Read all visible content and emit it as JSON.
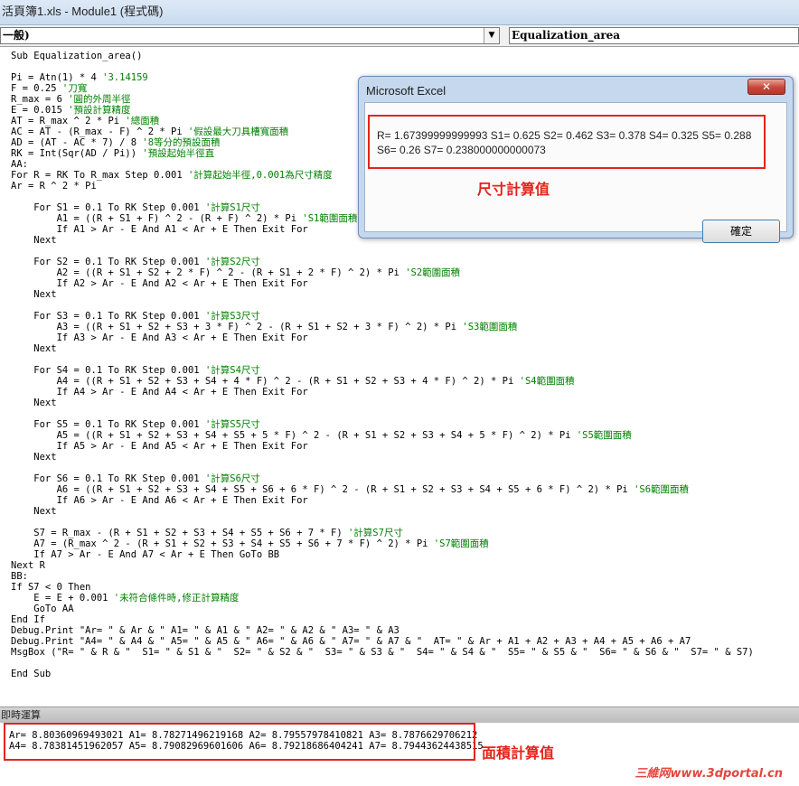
{
  "window": {
    "title": "活頁簿1.xls - Module1 (程式碼)"
  },
  "combos": {
    "object": "一般)",
    "procedure": "Equalization_area",
    "arrow": "▼"
  },
  "code": [
    [
      {
        "t": "Sub Equalization_area()"
      }
    ],
    [],
    [
      {
        "t": "Pi = Atn(1) * 4 "
      },
      {
        "t": "'3.14159",
        "c": "c"
      }
    ],
    [
      {
        "t": "F = 0.25 "
      },
      {
        "t": "'刀寬",
        "c": "c"
      }
    ],
    [
      {
        "t": "R_max = 6 "
      },
      {
        "t": "'圓的外周半徑",
        "c": "c"
      }
    ],
    [
      {
        "t": "E = 0.015 "
      },
      {
        "t": "'預設計算精度",
        "c": "c"
      }
    ],
    [
      {
        "t": "AT = R_max ^ 2 * Pi "
      },
      {
        "t": "'總面積",
        "c": "c"
      }
    ],
    [
      {
        "t": "AC = AT - (R_max - F) ^ 2 * Pi "
      },
      {
        "t": "'假設最大刀具槽寬面積",
        "c": "c"
      }
    ],
    [
      {
        "t": "AD = (AT - AC * 7) / 8 "
      },
      {
        "t": "'8等分的預設面積",
        "c": "c"
      }
    ],
    [
      {
        "t": "RK = Int(Sqr(AD / Pi)) "
      },
      {
        "t": "'預設起始半徑直",
        "c": "c"
      }
    ],
    [
      {
        "t": "AA:"
      }
    ],
    [
      {
        "t": "For R = RK To R_max Step 0.001 "
      },
      {
        "t": "'計算起始半徑,0.001為尺寸精度",
        "c": "c"
      }
    ],
    [
      {
        "t": "Ar = R ^ 2 * Pi"
      }
    ],
    [],
    [
      {
        "t": "    For S1 = 0.1 To RK Step 0.001 "
      },
      {
        "t": "'計算S1尺寸",
        "c": "c"
      }
    ],
    [
      {
        "t": "        A1 = ((R + S1 + F) ^ 2 - (R + F) ^ 2) * Pi "
      },
      {
        "t": "'S1範圍面積",
        "c": "c"
      }
    ],
    [
      {
        "t": "        If A1 > Ar - E And A1 < Ar + E Then Exit For"
      }
    ],
    [
      {
        "t": "    Next"
      }
    ],
    [],
    [
      {
        "t": "    For S2 = 0.1 To RK Step 0.001 "
      },
      {
        "t": "'計算S2尺寸",
        "c": "c"
      }
    ],
    [
      {
        "t": "        A2 = ((R + S1 + S2 + 2 * F) ^ 2 - (R + S1 + 2 * F) ^ 2) * Pi "
      },
      {
        "t": "'S2範圍面積",
        "c": "c"
      }
    ],
    [
      {
        "t": "        If A2 > Ar - E And A2 < Ar + E Then Exit For"
      }
    ],
    [
      {
        "t": "    Next"
      }
    ],
    [],
    [
      {
        "t": "    For S3 = 0.1 To RK Step 0.001 "
      },
      {
        "t": "'計算S3尺寸",
        "c": "c"
      }
    ],
    [
      {
        "t": "        A3 = ((R + S1 + S2 + S3 + 3 * F) ^ 2 - (R + S1 + S2 + 3 * F) ^ 2) * Pi "
      },
      {
        "t": "'S3範圍面積",
        "c": "c"
      }
    ],
    [
      {
        "t": "        If A3 > Ar - E And A3 < Ar + E Then Exit For"
      }
    ],
    [
      {
        "t": "    Next"
      }
    ],
    [],
    [
      {
        "t": "    For S4 = 0.1 To RK Step 0.001 "
      },
      {
        "t": "'計算S4尺寸",
        "c": "c"
      }
    ],
    [
      {
        "t": "        A4 = ((R + S1 + S2 + S3 + S4 + 4 * F) ^ 2 - (R + S1 + S2 + S3 + 4 * F) ^ 2) * Pi "
      },
      {
        "t": "'S4範圍面積",
        "c": "c"
      }
    ],
    [
      {
        "t": "        If A4 > Ar - E And A4 < Ar + E Then Exit For"
      }
    ],
    [
      {
        "t": "    Next"
      }
    ],
    [],
    [
      {
        "t": "    For S5 = 0.1 To RK Step 0.001 "
      },
      {
        "t": "'計算S5尺寸",
        "c": "c"
      }
    ],
    [
      {
        "t": "        A5 = ((R + S1 + S2 + S3 + S4 + S5 + 5 * F) ^ 2 - (R + S1 + S2 + S3 + S4 + 5 * F) ^ 2) * Pi "
      },
      {
        "t": "'S5範圍面積",
        "c": "c"
      }
    ],
    [
      {
        "t": "        If A5 > Ar - E And A5 < Ar + E Then Exit For"
      }
    ],
    [
      {
        "t": "    Next"
      }
    ],
    [],
    [
      {
        "t": "    For S6 = 0.1 To RK Step 0.001 "
      },
      {
        "t": "'計算S6尺寸",
        "c": "c"
      }
    ],
    [
      {
        "t": "        A6 = ((R + S1 + S2 + S3 + S4 + S5 + S6 + 6 * F) ^ 2 - (R + S1 + S2 + S3 + S4 + S5 + 6 * F) ^ 2) * Pi "
      },
      {
        "t": "'S6範圍面積",
        "c": "c"
      }
    ],
    [
      {
        "t": "        If A6 > Ar - E And A6 < Ar + E Then Exit For"
      }
    ],
    [
      {
        "t": "    Next"
      }
    ],
    [],
    [
      {
        "t": "    S7 = R_max - (R + S1 + S2 + S3 + S4 + S5 + S6 + 7 * F) "
      },
      {
        "t": "'計算S7尺寸",
        "c": "c"
      }
    ],
    [
      {
        "t": "    A7 = (R_max ^ 2 - (R + S1 + S2 + S3 + S4 + S5 + S6 + 7 * F) ^ 2) * Pi "
      },
      {
        "t": "'S7範圍面積",
        "c": "c"
      }
    ],
    [
      {
        "t": "    If A7 > Ar - E And A7 < Ar + E Then GoTo BB"
      }
    ],
    [
      {
        "t": "Next R"
      }
    ],
    [
      {
        "t": "BB:"
      }
    ],
    [
      {
        "t": "If S7 < 0 Then"
      }
    ],
    [
      {
        "t": "    E = E + 0.001 "
      },
      {
        "t": "'未符合條件時,修正計算精度",
        "c": "c"
      }
    ],
    [
      {
        "t": "    GoTo AA"
      }
    ],
    [
      {
        "t": "End If"
      }
    ],
    [
      {
        "t": "Debug.Print \"Ar= \" & Ar & \" A1= \" & A1 & \" A2= \" & A2 & \" A3= \" & A3"
      }
    ],
    [
      {
        "t": "Debug.Print \"A4= \" & A4 & \" A5= \" & A5 & \" A6= \" & A6 & \" A7= \" & A7 & \"  AT= \" & Ar + A1 + A2 + A3 + A4 + A5 + A6 + A7"
      }
    ],
    [
      {
        "t": "MsgBox (\"R= \" & R & \"  S1= \" & S1 & \"  S2= \" & S2 & \"  S3= \" & S3 & \"  S4= \" & S4 & \"  S5= \" & S5 & \"  S6= \" & S6 & \"  S7= \" & S7)"
      }
    ],
    [],
    [
      {
        "t": "End Sub"
      }
    ]
  ],
  "msgbox": {
    "title": "Microsoft Excel",
    "close": "✕",
    "text": "R= 1.67399999999993  S1= 0.625  S2= 0.462  S3= 0.378  S4= 0.325  S5= 0.288  S6= 0.26  S7= 0.238000000000073",
    "ok": "確定"
  },
  "annotations": {
    "size_label": "尺寸計算值",
    "area_label": "面積計算值"
  },
  "immediate": {
    "title": "即時運算",
    "lines": [
      "Ar= 8.80360969493021 A1= 8.78271496219168 A2= 8.79557978410821 A3= 8.7876629706212",
      "A4= 8.78381451962057 A5= 8.79082969601606 A6= 8.79218686404241 A7= 8.79443624438515"
    ]
  },
  "watermark": "三維网www.3dportal.cn",
  "colors": {
    "comment": "#008000",
    "annotation": "#e5231b"
  }
}
